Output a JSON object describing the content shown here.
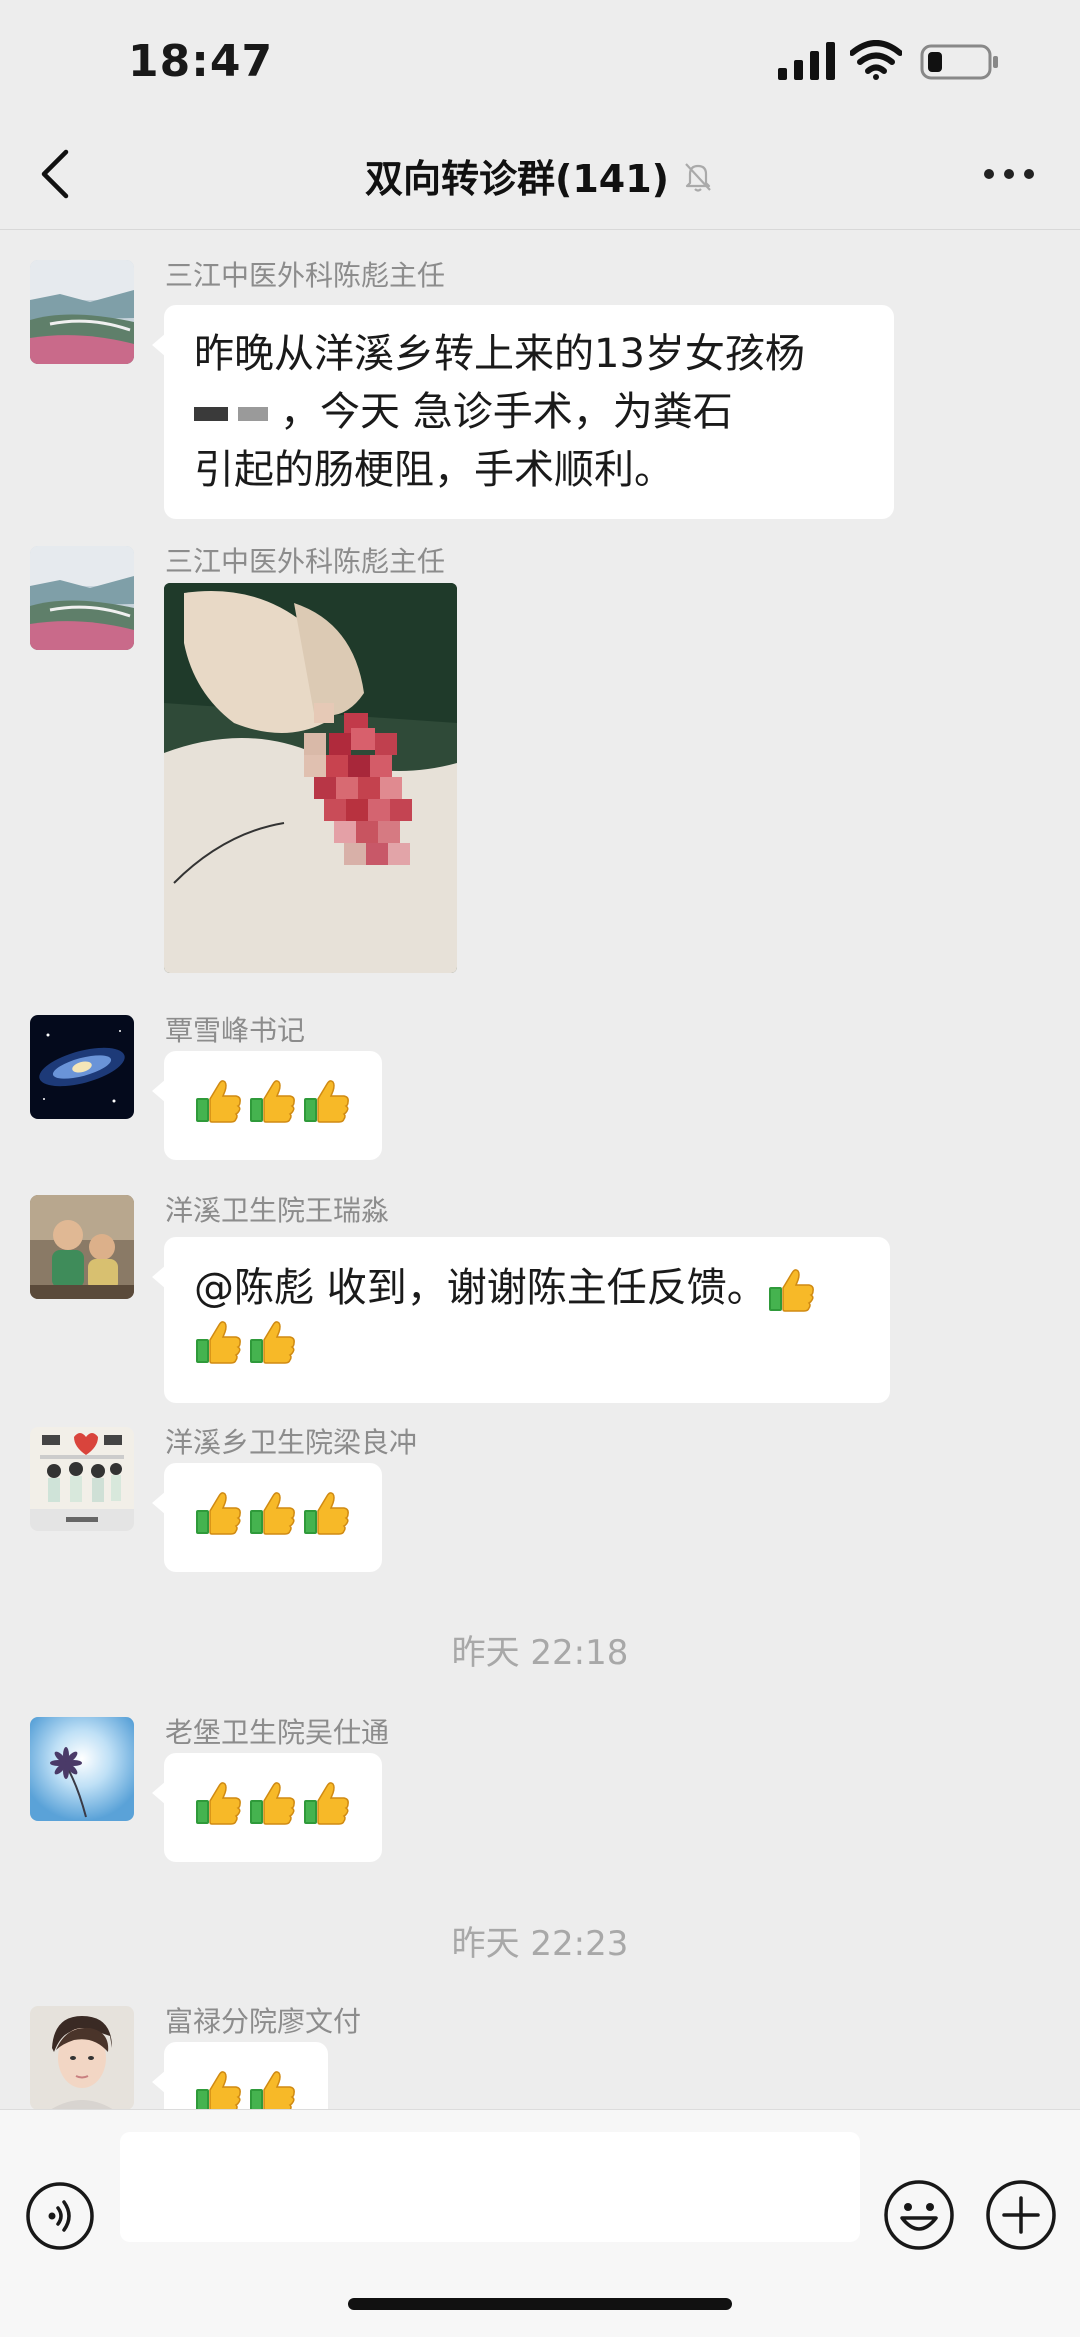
{
  "status": {
    "time": "18:47"
  },
  "nav": {
    "title": "双向转诊群(141)"
  },
  "messages": [
    {
      "sender": "三江中医外科陈彪主任",
      "lines": [
        "昨晚从洋溪乡转上来的13岁女孩杨",
        "，今天 急诊手术，为粪石",
        "引起的肠梗阻，手术顺利。"
      ]
    },
    {
      "sender": "三江中医外科陈彪主任",
      "image": "surgery-photo"
    },
    {
      "sender": "覃雪峰书记",
      "thumbs": 3
    },
    {
      "sender": "洋溪卫生院王瑞淼",
      "text": "@陈彪 收到，谢谢陈主任反馈。"
    },
    {
      "sender": "洋溪乡卫生院梁良冲",
      "thumbs": 3
    },
    {
      "sender": "老堡卫生院吴仕通",
      "thumbs": 3
    },
    {
      "sender": "富禄分院廖文付",
      "thumbs": 2
    }
  ],
  "timestamps": [
    "昨天 22:18",
    "昨天 22:23"
  ],
  "icons": {
    "back": "chevron-left-icon",
    "mute": "bell-muted-icon",
    "more": "more-dots-icon",
    "voice": "voice-icon",
    "emoji": "emoji-icon",
    "plus": "plus-icon",
    "thumb": "thumbs-up-icon"
  },
  "colors": {
    "background": "#ededed",
    "bubble": "#ffffff",
    "sender": "#8c8c8c"
  }
}
